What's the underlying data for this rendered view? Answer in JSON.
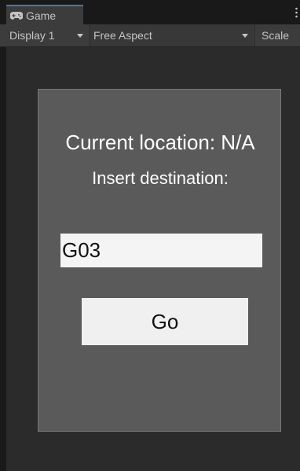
{
  "window": {
    "tab_label": "Game",
    "tab_icon": "gamepad-icon",
    "menu_icon": "kebab-menu-icon"
  },
  "toolbar": {
    "display_value": "Display 1",
    "aspect_value": "Free Aspect",
    "scale_label": "Scale"
  },
  "game": {
    "current_location_text": "Current location: N/A",
    "destination_label": "Insert destination:",
    "destination_value": "G03",
    "go_label": "Go"
  },
  "colors": {
    "tab_accent": "#3a79bb",
    "panel_bg": "#5a5a5a",
    "editor_bg": "#191919"
  }
}
